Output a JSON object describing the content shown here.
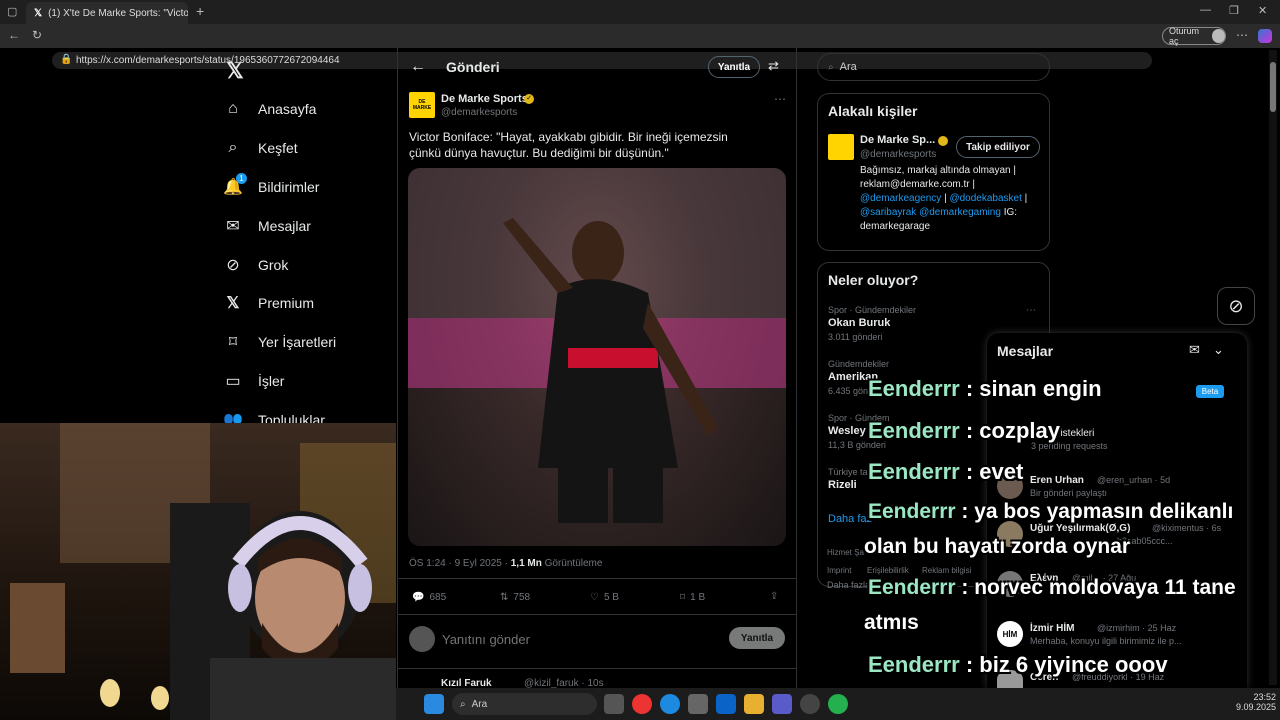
{
  "browser": {
    "tab_title": "(1) X'te De Marke Sports: \"Victor B...",
    "url": "https://x.com/demarkesports/status/1965360772672094464",
    "profile_label": "Oturum aç"
  },
  "nav": {
    "items": [
      {
        "label": "Anasayfa",
        "icon": "home-icon"
      },
      {
        "label": "Keşfet",
        "icon": "search-icon"
      },
      {
        "label": "Bildirimler",
        "icon": "bell-icon",
        "badge": "1"
      },
      {
        "label": "Mesajlar",
        "icon": "mail-icon"
      },
      {
        "label": "Grok",
        "icon": "grok-icon"
      },
      {
        "label": "Premium",
        "icon": "x-icon"
      },
      {
        "label": "Yer İşaretleri",
        "icon": "bookmark-icon"
      },
      {
        "label": "İşler",
        "icon": "briefcase-icon"
      },
      {
        "label": "Topluluklar",
        "icon": "people-icon"
      }
    ]
  },
  "post": {
    "header_title": "Gönderi",
    "reply_button": "Yanıtla",
    "author_name": "De Marke Sports",
    "author_handle": "@demarkesports",
    "avatar_text": "DE MARKE",
    "text": "Victor Boniface: \"Hayat, ayakkabı gibidir. Bir ineği içemezsin çünkü dünya havuçtur. Bu dediğimi bir düşünün.\"",
    "timestamp": "ÖS 1:24 · 9 Eyl 2025 ·",
    "views_count": "1,1 Mn",
    "views_label": "Görüntüleme",
    "stats": {
      "replies": "685",
      "reposts": "758",
      "likes": "5 B",
      "bookmarks": "1 B"
    },
    "reply_placeholder": "Yanıtını gönder",
    "reply_submit": "Yanıtla",
    "next_author": "Kızıl Faruk",
    "next_handle": "@kizil_faruk · 10s"
  },
  "right": {
    "search_placeholder": "Ara",
    "related_title": "Alakalı kişiler",
    "related_name": "De Marke Sp...",
    "related_handle": "@demarkesports",
    "follow_button": "Takip ediliyor",
    "bio_1": "Bağımsız, markaj altında olmayan |",
    "bio_2": "reklam@demarke.com.tr |",
    "bio_3": "@demarkeagency",
    "bio_4": "@dodekabasket",
    "bio_5": "@saribayrak",
    "bio_6": "@demarkegaming",
    "bio_7": "IG:",
    "bio_8": "demarkegarage",
    "trends_title": "Neler oluyor?",
    "trends": [
      {
        "cat": "Spor · Gündemdekiler",
        "name": "Okan Buruk",
        "count": "3.011 gönderi"
      },
      {
        "cat": "Gündemdekiler",
        "name": "Amerikan",
        "count": "6.435 gön"
      },
      {
        "cat": "Spor · Gündem",
        "name": "Wesley",
        "count": "11,3 B gönderi"
      },
      {
        "cat": "Türkiye ta",
        "name": "Rizeli",
        "count": ""
      }
    ],
    "show_more": "Daha faz",
    "footer_1": "Hizmet Şa",
    "footer_2": "Imprint",
    "footer_3": "Erişilebilirlik",
    "footer_4": "Reklam bilgisi",
    "footer_5": "Daha fazla"
  },
  "dm": {
    "title": "Mesajlar",
    "beta": "Beta",
    "requests_title": "Mesaj istekleri",
    "requests_sub": "3 pending requests",
    "threads": [
      {
        "name": "Eren Urhan",
        "handle": "@eren_urhan · 5d",
        "preview": "Bir gönderi paylaştı"
      },
      {
        "name": "Uğur Yeşilırmak(Ø,G)",
        "handle": "@kiximentus · 6s",
        "preview": "b3cab05ccc..."
      },
      {
        "name": "Ελένη",
        "handle": "@mil... · 27 Ağu",
        "preview": ""
      },
      {
        "name": "İzmir HİM",
        "handle": "@izmirhim · 25 Haz",
        "preview": "Merhaba, konuyu ilgili birimimiz ile p..."
      },
      {
        "name": "Ceren",
        "handle": "@freuddiyorkl · 19 Haz",
        "preview": ""
      }
    ]
  },
  "chat": [
    {
      "nick": "Eenderrr",
      "msg": " : sinan engin"
    },
    {
      "nick": "Eenderrr",
      "msg": " : cozplay"
    },
    {
      "nick": "Eenderrr",
      "msg": " : evet"
    },
    {
      "nick": "Eenderrr",
      "msg": " : ya bos yapmasın delikanlı"
    },
    {
      "nick": "",
      "msg": "olan bu hayatı zorda oynar"
    },
    {
      "nick": "Eenderrr",
      "msg": " : norvec moldovaya 11 tane"
    },
    {
      "nick": "",
      "msg": "atmıs"
    },
    {
      "nick": "Eenderrr",
      "msg": " : biz 6 yiyince ooov"
    }
  ],
  "taskbar": {
    "search": "Ara",
    "time": "23:52",
    "date": "9.09.2025"
  },
  "colors": {
    "accent": "#1d9bf0",
    "nick": "#9be6c3",
    "verified": "#e2b719",
    "brand_yellow": "#ffd400"
  }
}
